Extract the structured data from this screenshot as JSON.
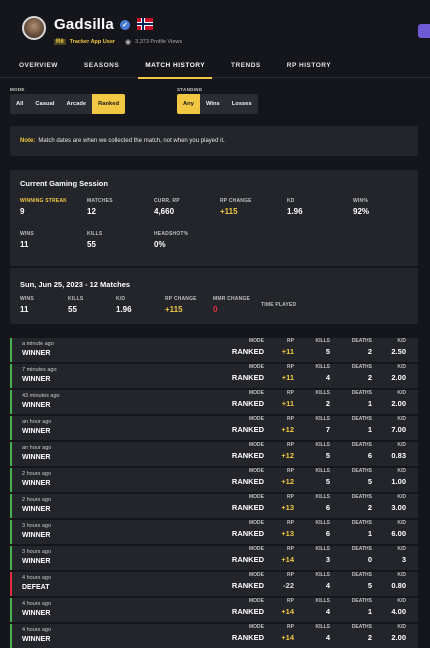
{
  "profile": {
    "username": "Gadsilla",
    "game_badge": "R6",
    "tracker_label": "Tracker App User",
    "views": "3,373 Profile Views"
  },
  "nav": [
    "OVERVIEW",
    "SEASONS",
    "MATCH HISTORY",
    "TRENDS",
    "RP HISTORY"
  ],
  "filters": {
    "mode_label": "MODE",
    "modes": [
      "All",
      "Casual",
      "Arcade",
      "Ranked"
    ],
    "standing_label": "STANDING",
    "standings": [
      "Any",
      "Wins",
      "Losses"
    ]
  },
  "note": {
    "prefix": "Note:",
    "text": "Match dates are when we collected the match, not when you played it."
  },
  "session": {
    "title": "Current Gaming Session",
    "stats": [
      {
        "label": "WINNING STREAK",
        "value": "9"
      },
      {
        "label": "MATCHES",
        "value": "12"
      },
      {
        "label": "CURR. RP",
        "value": "4,660"
      },
      {
        "label": "RP CHANGE",
        "value": "+115"
      },
      {
        "label": "KD",
        "value": "1.96"
      },
      {
        "label": "WIN%",
        "value": "92%"
      },
      {
        "label": "WINS",
        "value": "11"
      },
      {
        "label": "KILLS",
        "value": "55"
      },
      {
        "label": "HEADSHOT%",
        "value": "0%"
      }
    ]
  },
  "day": {
    "title": "Sun, Jun 25, 2023 - 12 Matches",
    "stats": [
      {
        "label": "WINS",
        "value": "11"
      },
      {
        "label": "KILLS",
        "value": "55"
      },
      {
        "label": "K/D",
        "value": "1.96"
      },
      {
        "label": "RP CHANGE",
        "value": "+115"
      },
      {
        "label": "MMR CHANGE",
        "value": "0"
      },
      {
        "label": "TIME PLAYED",
        "value": ""
      }
    ]
  },
  "match_headers": {
    "mode": "MODE",
    "rp": "RP",
    "kills": "KILLS",
    "deaths": "DEATHS",
    "kd": "K/D"
  },
  "matches": [
    {
      "time": "a minute ago",
      "result": "WINNER",
      "mode": "RANKED",
      "rp": "+11",
      "kills": "5",
      "deaths": "2",
      "kd": "2.50"
    },
    {
      "time": "7 minutes ago",
      "result": "WINNER",
      "mode": "RANKED",
      "rp": "+11",
      "kills": "4",
      "deaths": "2",
      "kd": "2.00"
    },
    {
      "time": "43 minutes ago",
      "result": "WINNER",
      "mode": "RANKED",
      "rp": "+11",
      "kills": "2",
      "deaths": "1",
      "kd": "2.00"
    },
    {
      "time": "an hour ago",
      "result": "WINNER",
      "mode": "RANKED",
      "rp": "+12",
      "kills": "7",
      "deaths": "1",
      "kd": "7.00"
    },
    {
      "time": "an hour ago",
      "result": "WINNER",
      "mode": "RANKED",
      "rp": "+12",
      "kills": "5",
      "deaths": "6",
      "kd": "0.83"
    },
    {
      "time": "2 hours ago",
      "result": "WINNER",
      "mode": "RANKED",
      "rp": "+12",
      "kills": "5",
      "deaths": "5",
      "kd": "1.00"
    },
    {
      "time": "2 hours ago",
      "result": "WINNER",
      "mode": "RANKED",
      "rp": "+13",
      "kills": "6",
      "deaths": "2",
      "kd": "3.00"
    },
    {
      "time": "3 hours ago",
      "result": "WINNER",
      "mode": "RANKED",
      "rp": "+13",
      "kills": "6",
      "deaths": "1",
      "kd": "6.00"
    },
    {
      "time": "3 hours ago",
      "result": "WINNER",
      "mode": "RANKED",
      "rp": "+14",
      "kills": "3",
      "deaths": "0",
      "kd": "3"
    },
    {
      "time": "4 hours ago",
      "result": "DEFEAT",
      "mode": "RANKED",
      "rp": "-22",
      "kills": "4",
      "deaths": "5",
      "kd": "0.80"
    },
    {
      "time": "4 hours ago",
      "result": "WINNER",
      "mode": "RANKED",
      "rp": "+14",
      "kills": "4",
      "deaths": "1",
      "kd": "4.00"
    },
    {
      "time": "4 hours ago",
      "result": "WINNER",
      "mode": "RANKED",
      "rp": "+14",
      "kills": "4",
      "deaths": "2",
      "kd": "2.00"
    }
  ],
  "colors": {
    "accent": "#f2c744",
    "win": "#4caf50",
    "loss": "#e5303d",
    "card": "#23252b",
    "background": "#15161b"
  }
}
